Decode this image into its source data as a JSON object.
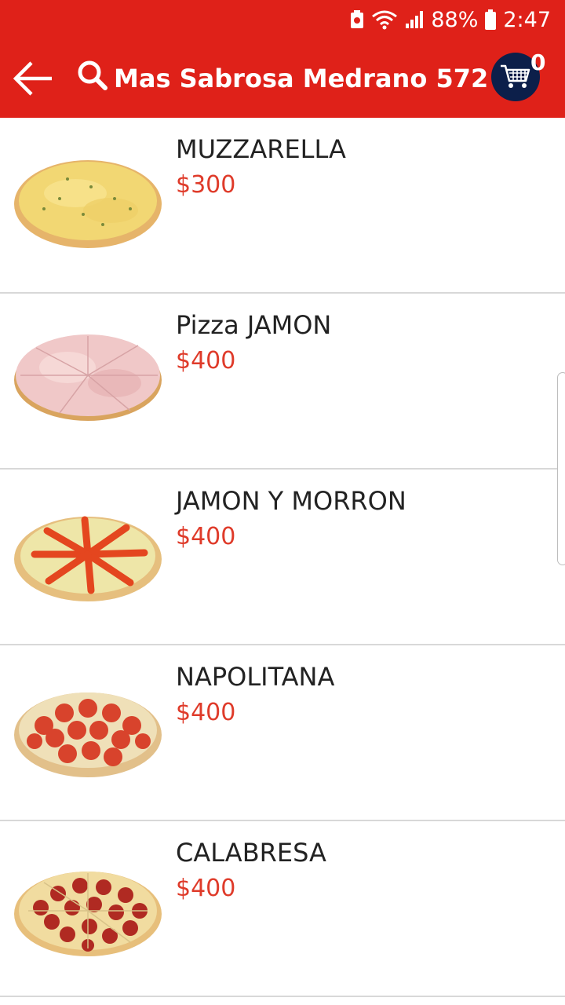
{
  "status_bar": {
    "battery": "88%",
    "time": "2:47"
  },
  "toolbar": {
    "title": "Mas Sabrosa Medrano 572",
    "cart_count": "0",
    "accent_color": "#df2119",
    "cart_color": "#0c1f4a"
  },
  "products": [
    {
      "name": "MUZZARELLA",
      "price": "$300",
      "icon": "pizza-mozzarella-image"
    },
    {
      "name": "Pizza JAMON",
      "price": "$400",
      "icon": "pizza-ham-image"
    },
    {
      "name": "JAMON Y MORRON",
      "price": "$400",
      "icon": "pizza-ham-pepper-image"
    },
    {
      "name": "NAPOLITANA",
      "price": "$400",
      "icon": "pizza-napolitana-image"
    },
    {
      "name": "CALABRESA",
      "price": "$400",
      "icon": "pizza-calabresa-image"
    }
  ]
}
